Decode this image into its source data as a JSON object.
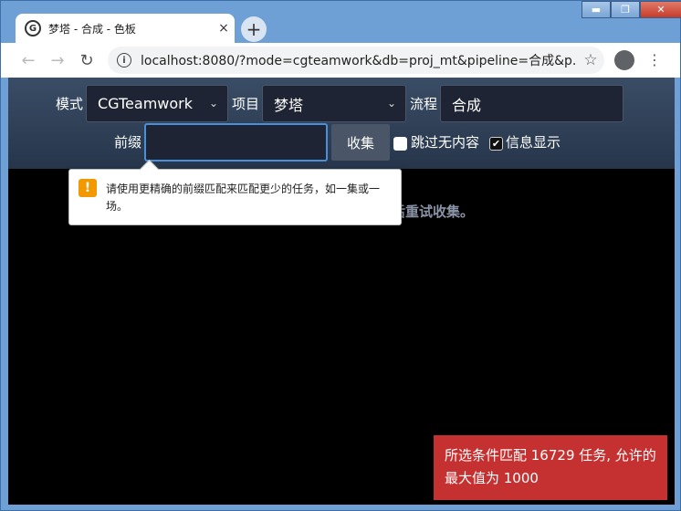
{
  "browser": {
    "tab_title": "梦塔 - 合成 - 色板",
    "tab_close": "×",
    "new_tab": "+",
    "url": "localhost:8080/?mode=cgteamwork&db=proj_mt&pipeline=合成&p..."
  },
  "window": {
    "minimize": "▬",
    "maximize": "❐",
    "close": "✕"
  },
  "form": {
    "mode_label": "模式",
    "mode_value": "CGTeamwork",
    "project_label": "项目",
    "project_value": "梦塔",
    "pipeline_label": "流程",
    "pipeline_value": "合成",
    "prefix_label": "前缀",
    "prefix_value": "",
    "collect_button": "收集",
    "skip_empty_label": "跳过无内容",
    "skip_empty_checked": false,
    "show_info_label": "信息显示",
    "show_info_checked": true
  },
  "background_message": "后重试收集。",
  "tooltip": {
    "message": "请使用更精确的前缀匹配来匹配更少的任务，如一集或一场。"
  },
  "toast": {
    "message": "所选条件匹配 16729 任务, 允许的最大值为 1000",
    "color": "#c53030"
  }
}
